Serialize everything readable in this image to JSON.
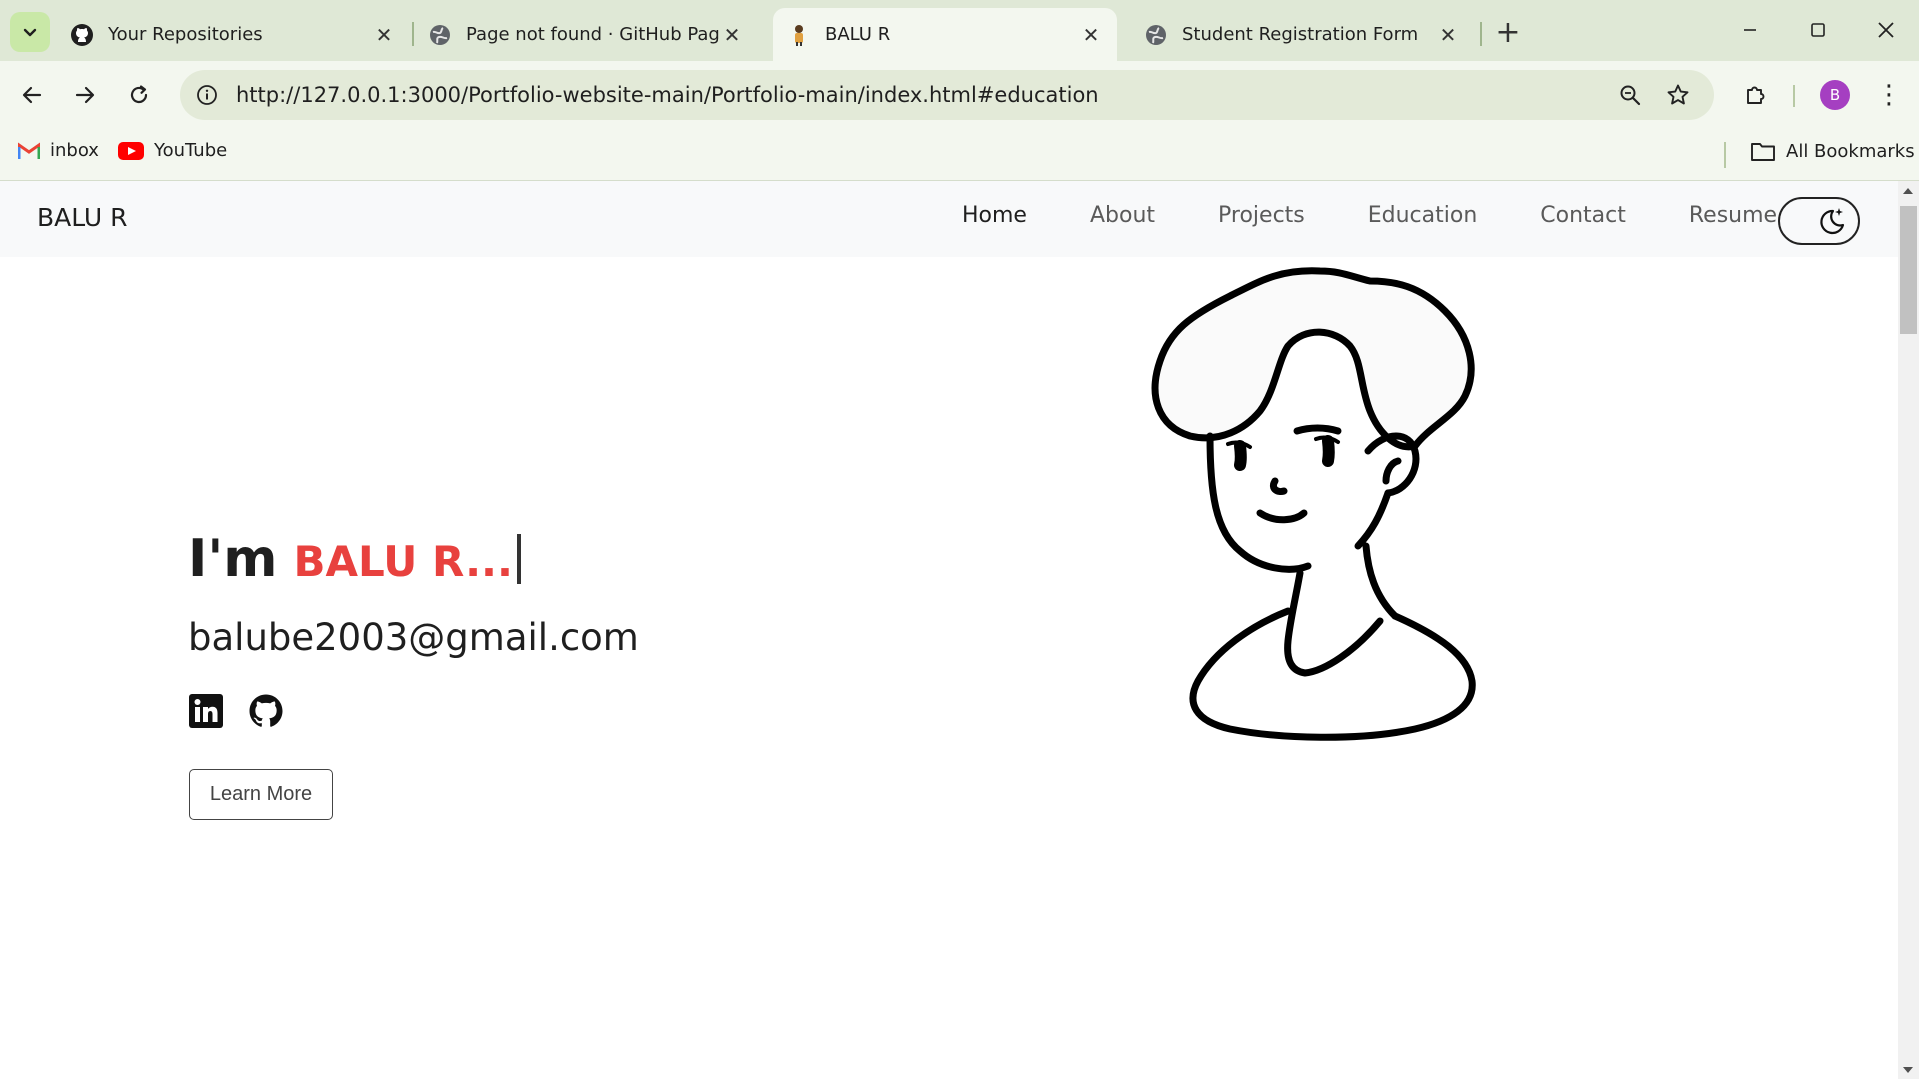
{
  "browser": {
    "tabs": [
      {
        "title": "Your Repositories",
        "icon": "github-icon",
        "active": false
      },
      {
        "title": "Page not found · GitHub Pages",
        "icon": "globe-icon",
        "active": false
      },
      {
        "title": "BALU R",
        "icon": "person-favicon",
        "active": true
      },
      {
        "title": "Student Registration Form",
        "icon": "globe-icon",
        "active": false
      }
    ],
    "url": "http://127.0.0.1:3000/Portfolio-website-main/Portfolio-main/index.html#education",
    "profile_initial": "B",
    "bookmarks": [
      {
        "label": "inbox",
        "icon": "gmail-icon"
      },
      {
        "label": "YouTube",
        "icon": "youtube-icon"
      }
    ],
    "all_bookmarks_label": "All Bookmarks"
  },
  "site": {
    "brand": "BALU R",
    "nav": [
      {
        "label": "Home",
        "active": true
      },
      {
        "label": "About",
        "active": false
      },
      {
        "label": "Projects",
        "active": false
      },
      {
        "label": "Education",
        "active": false
      },
      {
        "label": "Contact",
        "active": false
      },
      {
        "label": "Resume",
        "active": false
      }
    ],
    "theme_toggle_icon": "moon-stars-icon"
  },
  "hero": {
    "prefix": "I'm",
    "name": "BALU R...",
    "email": "balube2003@gmail.com",
    "socials": [
      "linkedin-icon",
      "github-icon"
    ],
    "cta_label": "Learn More"
  },
  "colors": {
    "accent": "#e8413e",
    "chrome_bg": "#dfe8d6",
    "toolbar_bg": "#f3f7ef",
    "avatar_bg": "#a53fc1"
  }
}
